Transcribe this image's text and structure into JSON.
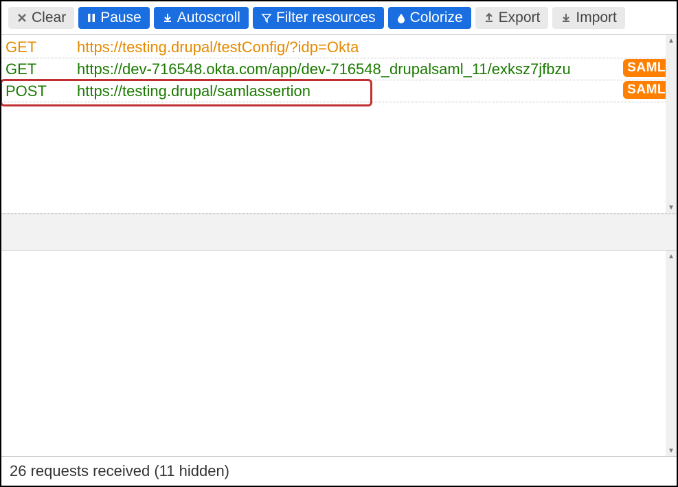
{
  "toolbar": {
    "clear": "Clear",
    "pause": "Pause",
    "autoscroll": "Autoscroll",
    "filter": "Filter resources",
    "colorize": "Colorize",
    "export": "Export",
    "import": "Import"
  },
  "requests": [
    {
      "method": "GET",
      "url": "https://testing.drupal/testConfig/?idp=Okta",
      "color": "orange",
      "badge": ""
    },
    {
      "method": "GET",
      "url": "https://dev-716548.okta.com/app/dev-716548_drupalsaml_11/exksz7jfbzu",
      "color": "green",
      "badge": "SAML"
    },
    {
      "method": "POST",
      "url": "https://testing.drupal/samlassertion",
      "color": "green",
      "badge": "SAML"
    }
  ],
  "status": "26 requests received (11 hidden)"
}
